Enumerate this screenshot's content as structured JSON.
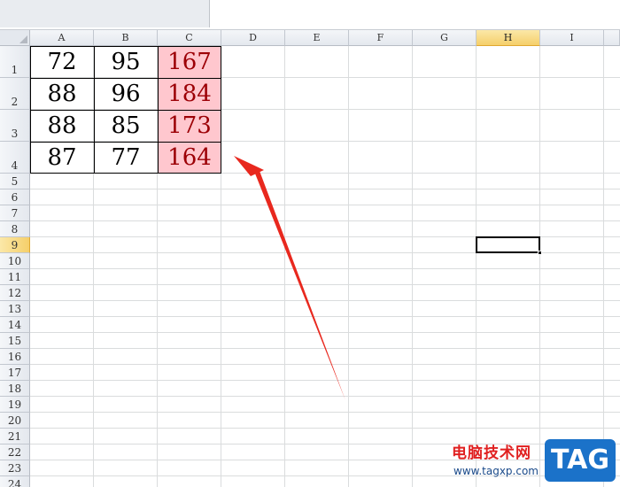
{
  "columns": [
    "A",
    "B",
    "C",
    "D",
    "E",
    "F",
    "G",
    "H",
    "I"
  ],
  "rows": [
    "1",
    "2",
    "3",
    "4",
    "5",
    "6",
    "7",
    "8",
    "9",
    "10",
    "11",
    "12",
    "13",
    "14",
    "15",
    "16",
    "17",
    "18",
    "19",
    "20",
    "21",
    "22",
    "23",
    "24"
  ],
  "active_column": "H",
  "active_row": "9",
  "data": [
    [
      "72",
      "95",
      "167"
    ],
    [
      "88",
      "96",
      "184"
    ],
    [
      "88",
      "85",
      "173"
    ],
    [
      "87",
      "77",
      "164"
    ]
  ],
  "colors": {
    "sum_fill": "#ffc7ce",
    "sum_text": "#9c0006",
    "arrow": "#e8281e",
    "header_active": "#f5cf6a"
  },
  "watermark": {
    "site_name": "电脑技术网",
    "url": "www.tagxp.com",
    "tag": "TAG"
  }
}
